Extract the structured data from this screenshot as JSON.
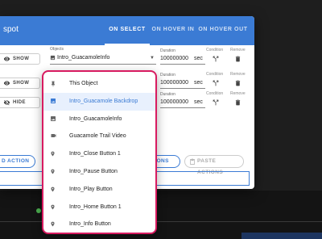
{
  "dialog": {
    "title": "spot",
    "tabs": [
      "ON SELECT",
      "ON HOVER IN",
      "ON HOVER OUT"
    ],
    "rows": [
      {
        "visibility": "SHOW",
        "object_label": "Objects",
        "object_value": "Intro_GuacamoleInfo",
        "duration_label": "Duration",
        "duration_value": "100000000",
        "unit": "sec",
        "condition_label": "Condition",
        "remove_label": "Remove"
      },
      {
        "visibility": "SHOW",
        "duration_label": "Duration",
        "duration_value": "100000000",
        "unit": "sec",
        "condition_label": "Condition",
        "remove_label": "Remove"
      },
      {
        "visibility": "HIDE",
        "duration_label": "Duration",
        "duration_value": "100000000",
        "unit": "sec",
        "condition_label": "Condition",
        "remove_label": "Remove"
      }
    ],
    "add_action": "D ACTION",
    "actions_btn": "TIONS",
    "paste_actions": "PASTE ACTIONS"
  },
  "menu": {
    "items": [
      {
        "label": "This Object",
        "icon": "pin-icon"
      },
      {
        "label": "Intro_Guacamole Backdrop",
        "icon": "image-icon",
        "selected": true
      },
      {
        "label": "Intro_GuacamoleInfo",
        "icon": "image-icon"
      },
      {
        "label": "Guacamole Trail Video",
        "icon": "video-icon"
      },
      {
        "label": "Intro_Close Button 1",
        "icon": "location-pin-icon"
      },
      {
        "label": "Intro_Pause Button",
        "icon": "location-pin-icon"
      },
      {
        "label": "Intro_Play Button",
        "icon": "location-pin-icon"
      },
      {
        "label": "Intro_Home Button 1",
        "icon": "location-pin-icon"
      },
      {
        "label": "Intro_Info Button",
        "icon": "location-pin-icon"
      }
    ]
  },
  "colors": {
    "accent": "#3b7bd4",
    "menu_border": "#d81b60",
    "selected_bg": "#e8f0fd"
  }
}
